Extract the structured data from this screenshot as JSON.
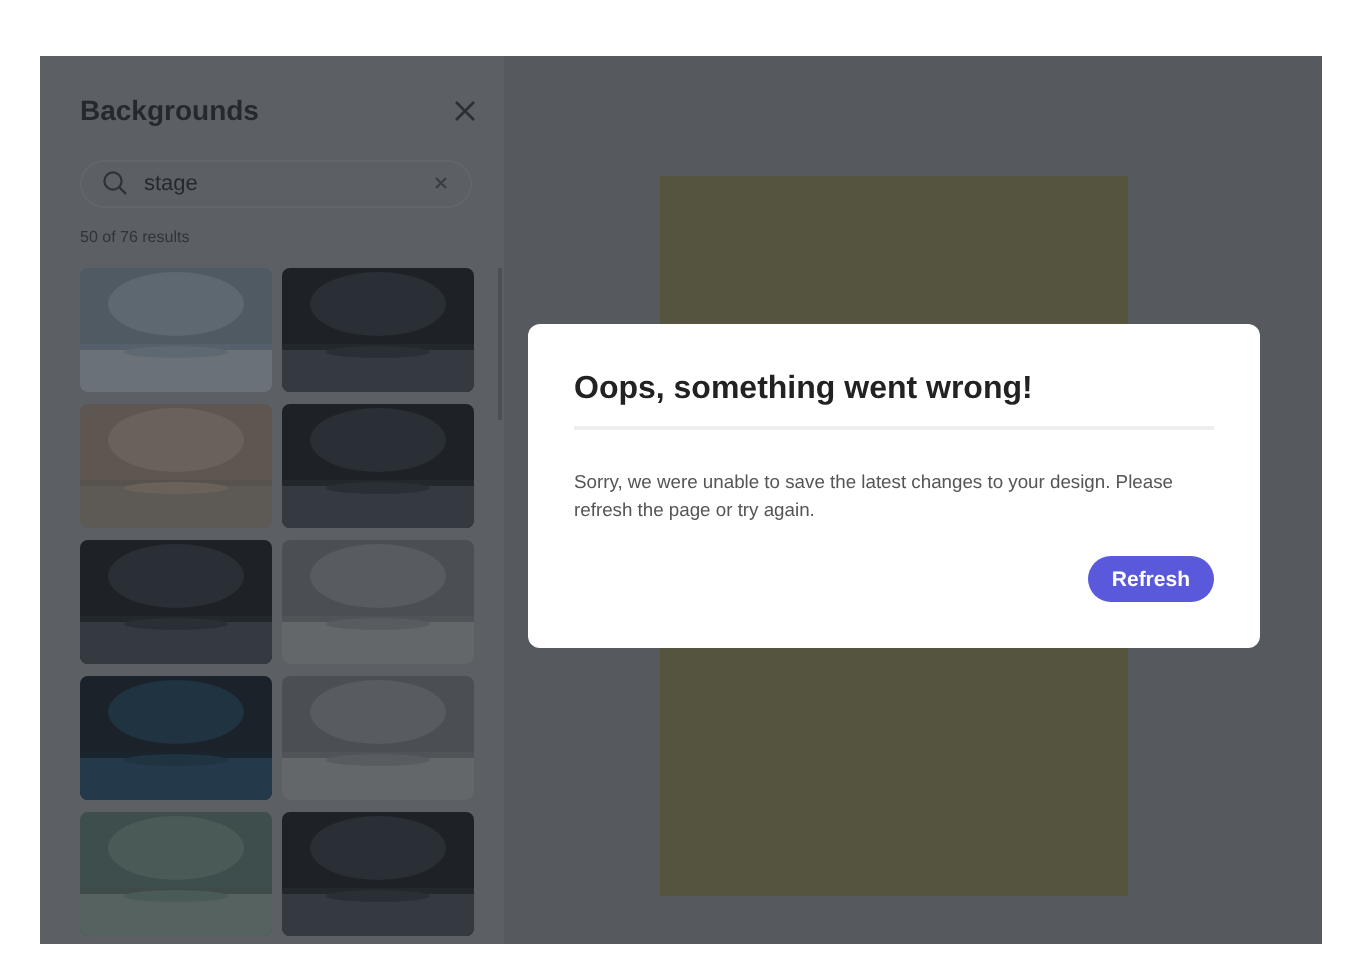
{
  "panel": {
    "title": "Backgrounds",
    "search": {
      "value": "stage"
    },
    "result_count": "50 of 76 results"
  },
  "dialog": {
    "title": "Oops, something went wrong!",
    "message": "Sorry, we were unable to save the latest changes to your design. Please refresh the page or try again.",
    "button": "Refresh"
  }
}
